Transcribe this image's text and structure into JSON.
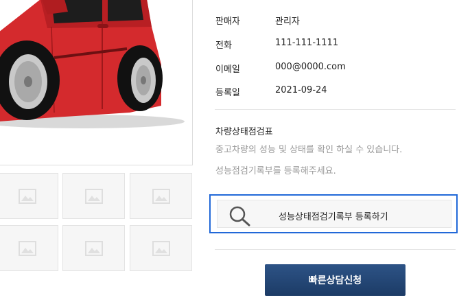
{
  "seller": {
    "rows": [
      {
        "label": "판매자",
        "value": "관리자"
      },
      {
        "label": "전화",
        "value": "111-111-1111"
      },
      {
        "label": "이메일",
        "value": "000@0000.com"
      },
      {
        "label": "등록일",
        "value": "2021-09-24"
      }
    ]
  },
  "inspection": {
    "title": "차량상태점검표",
    "desc_line1": "중고차량의 성능 및 상태를 확인 하실 수 있습니다.",
    "desc_line2": "성능점검기록부를 등록해주세요.",
    "register_button": "성능상태점검기록부 등록하기"
  },
  "consult_button": "빠른상담신청",
  "colors": {
    "car_red": "#d42a2d",
    "accent_border": "#2168d8",
    "button_navy": "#234a7c"
  },
  "icons": {
    "search": "magnifier-icon",
    "thumbnail_placeholder": "image-placeholder-icon"
  }
}
